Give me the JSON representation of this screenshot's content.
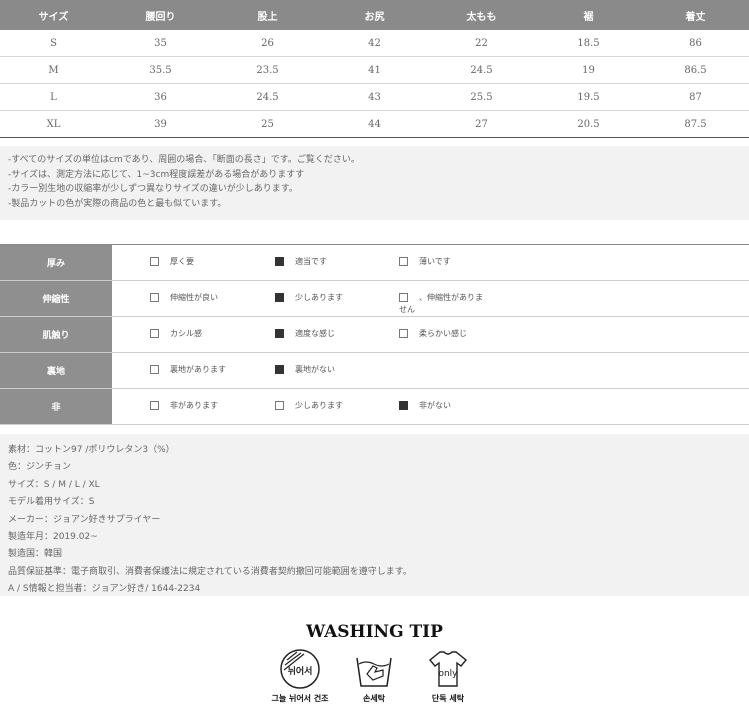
{
  "size_table": {
    "headers": [
      "サイズ",
      "腰回り",
      "股上",
      "お尻",
      "太もも",
      "裾",
      "着丈"
    ],
    "rows": [
      [
        "S",
        "35",
        "26",
        "42",
        "22",
        "18.5",
        "86"
      ],
      [
        "M",
        "35.5",
        "23.5",
        "41",
        "24.5",
        "19",
        "86.5"
      ],
      [
        "L",
        "36",
        "24.5",
        "43",
        "25.5",
        "19.5",
        "87"
      ],
      [
        "XL",
        "39",
        "25",
        "44",
        "27",
        "20.5",
        "87.5"
      ]
    ]
  },
  "notes": [
    "-すべてのサイズの単位はcmであり、周囲の場合、「断面の長さ」です。ご覧ください。",
    "-サイズは、測定方法に応じて、1~3cm程度誤差がある場合がありますす",
    "-カラー別生地の収縮率が少しずつ異なりサイズの違いが少しあります。",
    "-製品カットの色が実際の商品の色と最も似ています。"
  ],
  "features": [
    {
      "label": "厚み",
      "options": [
        {
          "text": "厚く要",
          "checked": false
        },
        {
          "text": "適当です",
          "checked": true
        },
        {
          "text": "薄いです",
          "checked": false
        }
      ]
    },
    {
      "label": "伸縮性",
      "options": [
        {
          "text": "伸縮性が良い",
          "checked": false
        },
        {
          "text": "少しあります",
          "checked": true
        },
        {
          "text": "、伸縮性がありま",
          "text2": "せん",
          "checked": false
        }
      ]
    },
    {
      "label": "肌触り",
      "options": [
        {
          "text": "カシル感",
          "checked": false
        },
        {
          "text": "適度な感じ",
          "checked": true
        },
        {
          "text": "柔らかい感じ",
          "checked": false
        }
      ]
    },
    {
      "label": "裏地",
      "options": [
        {
          "text": "裏地があります",
          "checked": false
        },
        {
          "text": "裏地がない",
          "checked": true
        }
      ]
    },
    {
      "label": "非",
      "options": [
        {
          "text": "非があります",
          "checked": false
        },
        {
          "text": "少しあります",
          "checked": false
        },
        {
          "text": "非がない",
          "checked": true
        }
      ]
    }
  ],
  "specs": [
    "素材：コットン97 /ポリウレタン3（%）",
    "色：ジンチョン",
    "サイズ：S / M / L / XL",
    "モデル着用サイズ：S",
    "メーカー：ジョアン好きサプライヤー",
    "製造年月：2019.02~",
    "製造国：韓国",
    "品質保証基準：電子商取引、消費者保護法に規定されている消費者契約撤回可能範囲を遵守します。",
    "A / S情報と担当者：ジョアン好き/ 1644-2234"
  ],
  "washing": {
    "title": "WASHING TIP",
    "items": [
      {
        "icon": "shade-dry-icon",
        "label": "그늘 뉘어서 건조",
        "icon_text": "뉘어서"
      },
      {
        "icon": "hand-wash-icon",
        "label": "손세탁"
      },
      {
        "icon": "separate-wash-icon",
        "label": "단독 세탁",
        "icon_text": "only"
      }
    ]
  }
}
